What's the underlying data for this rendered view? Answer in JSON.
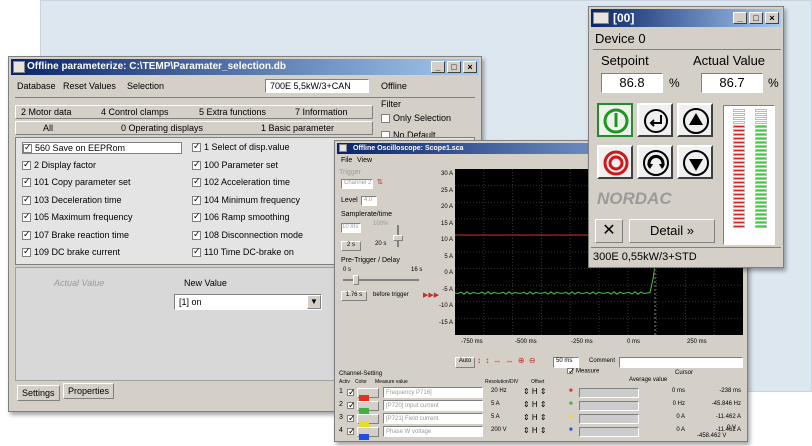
{
  "param_window": {
    "title": "Offline parameterize: C:\\TEMP\\Paramater_selection.db",
    "menu": [
      "Database",
      "Reset Values",
      "Selection"
    ],
    "device": "700E 5,5kW/3+CAN",
    "mode": "Offline",
    "tabs_row1": [
      "2 Motor data",
      "4 Control clamps",
      "5 Extra functions",
      "7 Information"
    ],
    "tabs_row2": [
      "All",
      "0 Operating displays",
      "1 Basic parameter"
    ],
    "filter": {
      "title": "Filter",
      "only_selection": "Only Selection",
      "no_default": "No Default"
    },
    "params_left": [
      "560  Save on EEPRom",
      "2  Display factor",
      "101  Copy parameter set",
      "103  Deceleration time",
      "105  Maximum frequency",
      "107  Brake reaction time",
      "109  DC brake current"
    ],
    "params_right": [
      "1  Select of disp.value",
      "100  Parameter set",
      "102  Acceleration time",
      "104  Minimum frequency",
      "106  Ramp smoothing",
      "108  Disconnection mode",
      "110  Time DC-brake on"
    ],
    "actual_value_label": "Actual Value",
    "new_value_label": "New Value",
    "new_value": "[1] on",
    "bottom_tabs": [
      "Settings",
      "Properties"
    ]
  },
  "scope_window": {
    "title": "Offline Oscilloscope: Scope1.sca",
    "menu": [
      "File",
      "View"
    ],
    "trigger_label": "Trigger",
    "trigger_channel": "Channel 2",
    "level_label": "Level",
    "level_value": "4.0",
    "samplerate_label": "Samplerate/time",
    "samplerate_value": "10 ms",
    "samplerate_pct": "100%",
    "time_value": "2 s",
    "time_value2": "20 s",
    "pretrigger_label": "Pre-Trigger / Delay",
    "pretrigger_min": "0 s",
    "pretrigger_max": "16 s",
    "pretrigger_value": "1.76 s",
    "pretrigger_note": "before trigger",
    "y_ticks": [
      "30 A",
      "25 A",
      "20 A",
      "15 A",
      "10 A",
      "5 A",
      "0 A",
      "-5 A",
      "-10 A",
      "-15 A"
    ],
    "x_ticks": [
      "-750 ms",
      "-500 ms",
      "-250 ms",
      "0 ms",
      "250 ms"
    ],
    "toolbar_auto": "Auto",
    "zoom_value": "50 ms",
    "comment_label": "Comment",
    "channel_setting_label": "Channel-Setting",
    "col_headers": [
      "Activ",
      "Color",
      "Measure value",
      "Resolution/DIV",
      "Offset"
    ],
    "measure_label": "Measure",
    "average_label": "Average value",
    "cursor_label": "Cursor",
    "channels": [
      {
        "num": "1",
        "color": "#e03020",
        "name": "Frequency P716]",
        "res": "20 Hz",
        "avg": "0 ms",
        "cursor": "-238 ms"
      },
      {
        "num": "2",
        "color": "#40b040",
        "name": "[P720] Input current",
        "res": "5 A",
        "avg": "0 Hz",
        "cursor": "-45.846 Hz"
      },
      {
        "num": "3",
        "color": "#e0e020",
        "name": "[P721] Field current",
        "res": "5 A",
        "avg": "0 A",
        "cursor": "-11.462 A"
      },
      {
        "num": "4",
        "color": "#2050e0",
        "name": "Phase W voltage",
        "res": "200 V",
        "avg": "0 A",
        "cursor": "-11.462 A"
      }
    ],
    "extra_cursor": [
      "0 V",
      "-458.462 V"
    ]
  },
  "nordac_window": {
    "title": "[00]",
    "device": "Device 0",
    "setpoint_label": "Setpoint",
    "actual_label": "Actual Value",
    "setpoint": "86.8",
    "actual": "86.7",
    "unit": "%",
    "brand": "NORDAC",
    "detail_label": "Detail »",
    "status": "300E 0,55kW/3+STD",
    "setpoint_level": 0.868,
    "actual_level": 0.867,
    "colors": {
      "green_led": "#3cc83c",
      "red_led": "#e02020",
      "led_off": "#ffffff"
    }
  }
}
